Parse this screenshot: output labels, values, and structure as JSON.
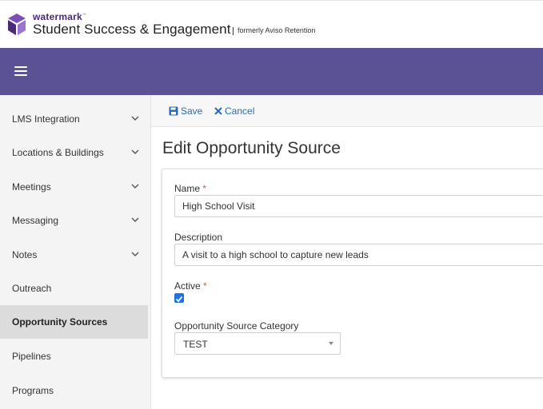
{
  "header": {
    "brand_small": "watermark",
    "brand_tm": "™",
    "brand_title": "Student Success & Engagement",
    "brand_formerly": "formerly Aviso Retention"
  },
  "sidebar": {
    "items": [
      {
        "label": "LMS Integration",
        "expandable": true
      },
      {
        "label": "Locations & Buildings",
        "expandable": true
      },
      {
        "label": "Meetings",
        "expandable": true
      },
      {
        "label": "Messaging",
        "expandable": true
      },
      {
        "label": "Notes",
        "expandable": true
      },
      {
        "label": "Outreach",
        "expandable": false
      },
      {
        "label": "Opportunity Sources",
        "expandable": false,
        "active": true
      },
      {
        "label": "Pipelines",
        "expandable": false
      },
      {
        "label": "Programs",
        "expandable": false
      }
    ]
  },
  "toolbar": {
    "save_label": "Save",
    "cancel_label": "Cancel"
  },
  "page": {
    "title": "Edit Opportunity Source"
  },
  "form": {
    "name_label": "Name",
    "name_value": "High School Visit",
    "description_label": "Description",
    "description_value": "A visit to a high school to capture new leads",
    "active_label": "Active",
    "active_checked": true,
    "required_marker": "*",
    "category_label": "Opportunity Source Category",
    "category_value": "TEST"
  },
  "colors": {
    "navbar": "#5a5294",
    "link": "#2a6db5",
    "required": "#d9534f",
    "checkbox": "#1a73e8",
    "active_sidebar": "#dcdcdc"
  }
}
